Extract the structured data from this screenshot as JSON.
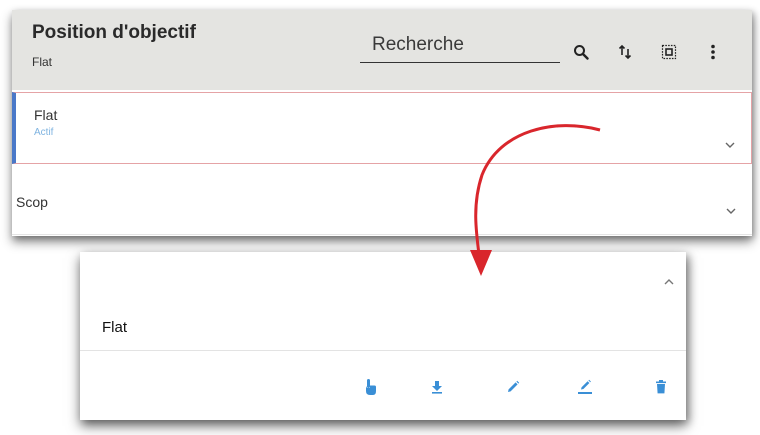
{
  "header": {
    "title": "Position d'objectif",
    "subtitle": "Flat",
    "search_label": "Recherche",
    "icons": [
      "search-icon",
      "sort-icon",
      "select-all-icon",
      "more-vert-icon"
    ]
  },
  "list": {
    "items": [
      {
        "name": "Flat",
        "status": "Actif"
      },
      {
        "name": "Scop",
        "status": ""
      }
    ]
  },
  "detail": {
    "name": "Flat",
    "actions": [
      "touch-icon",
      "download-icon",
      "edit-icon",
      "rename-icon",
      "delete-icon"
    ]
  },
  "colors": {
    "accent_blue": "#3a8fd6",
    "annotation_red": "#d9262c",
    "header_bg": "#e4e4e1"
  }
}
